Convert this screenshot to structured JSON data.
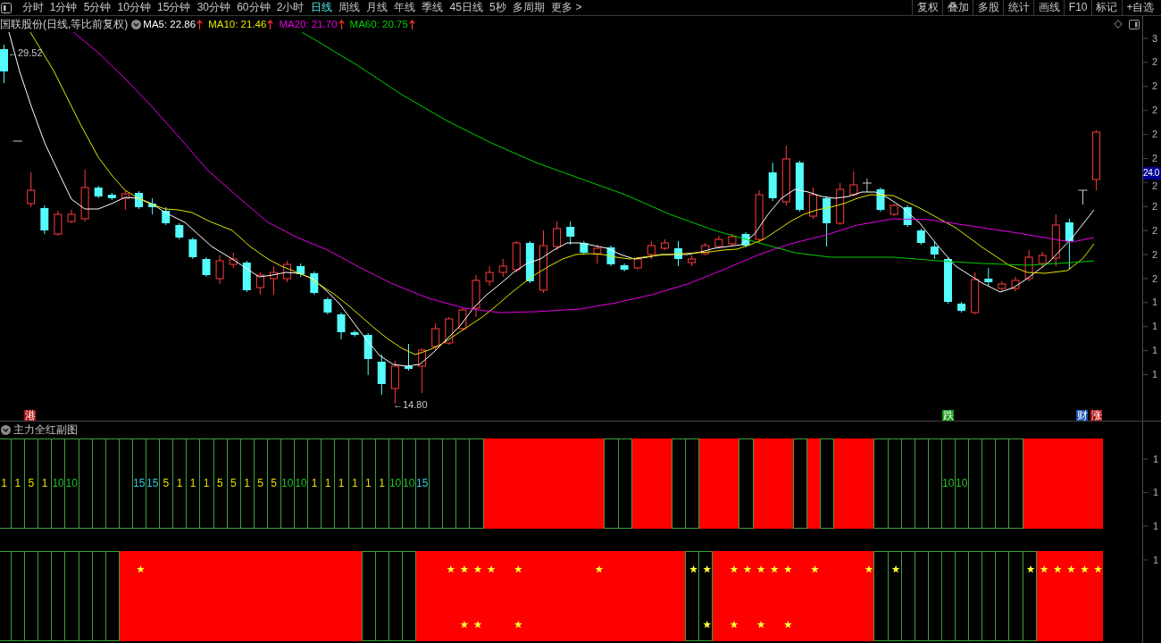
{
  "toolbar": {
    "periods": [
      {
        "label": "分时",
        "selected": false
      },
      {
        "label": "1分钟",
        "selected": false
      },
      {
        "label": "5分钟",
        "selected": false
      },
      {
        "label": "10分钟",
        "selected": false
      },
      {
        "label": "15分钟",
        "selected": false
      },
      {
        "label": "30分钟",
        "selected": false
      },
      {
        "label": "60分钟",
        "selected": false
      },
      {
        "label": "2小时",
        "selected": false
      },
      {
        "label": "日线",
        "selected": true
      },
      {
        "label": "周线",
        "selected": false
      },
      {
        "label": "月线",
        "selected": false
      },
      {
        "label": "年线",
        "selected": false
      },
      {
        "label": "季线",
        "selected": false
      },
      {
        "label": "45日线",
        "selected": false
      },
      {
        "label": "5秒",
        "selected": false
      },
      {
        "label": "多周期",
        "selected": false
      },
      {
        "label": "更多 >",
        "selected": false
      }
    ],
    "actions": [
      "复权",
      "叠加",
      "多股",
      "统计",
      "画线",
      "F10",
      "标记",
      "+自选"
    ]
  },
  "chart_header": {
    "title": "国联股份(日线,等比前复权)",
    "indicators": [
      {
        "label": "MA5: 22.86",
        "color": "#ffffff",
        "rising": true
      },
      {
        "label": "MA10: 21.46",
        "color": "#e6e600",
        "rising": true
      },
      {
        "label": "MA20: 21.70",
        "color": "#e600e6",
        "rising": true
      },
      {
        "label": "MA60: 20.75",
        "color": "#00d000",
        "rising": true
      }
    ]
  },
  "main_chart": {
    "high_label": "←29.52",
    "low_label": "←14.80",
    "markers": [
      {
        "text": "港",
        "color": "#b01010"
      },
      {
        "text": "跌",
        "color": "#109a10"
      },
      {
        "text": "财",
        "color": "#1050b0"
      },
      {
        "text": "涨",
        "color": "#b01010"
      }
    ],
    "axis_labels": [
      "3",
      "2",
      "2",
      "2",
      "2",
      "2",
      "2",
      "2",
      "2",
      "2",
      "2",
      "1",
      "1",
      "1",
      "1"
    ],
    "price_tag": "24.0"
  },
  "sub_chart": {
    "title": "主力全红副图",
    "panels": [
      {
        "axis_labels": [
          "1",
          "1",
          "1"
        ],
        "columns": [
          {
            "kind": "outline",
            "label": "1",
            "color": "#e0e000"
          },
          {
            "kind": "outline",
            "label": "1",
            "color": "#e0e000"
          },
          {
            "kind": "outline",
            "label": "5",
            "color": "#e0e000"
          },
          {
            "kind": "outline",
            "label": "1",
            "color": "#e0e000"
          },
          {
            "kind": "outline",
            "label": "10",
            "color": "#20c020"
          },
          {
            "kind": "outline",
            "label": "10",
            "color": "#20c020"
          },
          {
            "kind": "outline"
          },
          {
            "kind": "outline"
          },
          {
            "kind": "outline"
          },
          {
            "kind": "outline"
          },
          {
            "kind": "outline",
            "label": "15",
            "color": "#30c8e0"
          },
          {
            "kind": "outline",
            "label": "15",
            "color": "#30c8e0"
          },
          {
            "kind": "outline",
            "label": "5",
            "color": "#e0e000"
          },
          {
            "kind": "outline",
            "label": "1",
            "color": "#e0e000"
          },
          {
            "kind": "outline",
            "label": "1",
            "color": "#e0e000"
          },
          {
            "kind": "outline",
            "label": "1",
            "color": "#e0e000"
          },
          {
            "kind": "outline",
            "label": "5",
            "color": "#e0e000"
          },
          {
            "kind": "outline",
            "label": "5",
            "color": "#e0e000"
          },
          {
            "kind": "outline",
            "label": "1",
            "color": "#e0e000"
          },
          {
            "kind": "outline",
            "label": "5",
            "color": "#e0e000"
          },
          {
            "kind": "outline",
            "label": "5",
            "color": "#e0e000"
          },
          {
            "kind": "outline",
            "label": "10",
            "color": "#20c020"
          },
          {
            "kind": "outline",
            "label": "10",
            "color": "#20c020"
          },
          {
            "kind": "outline",
            "label": "1",
            "color": "#e0e000"
          },
          {
            "kind": "outline",
            "label": "1",
            "color": "#e0e000"
          },
          {
            "kind": "outline",
            "label": "1",
            "color": "#e0e000"
          },
          {
            "kind": "outline",
            "label": "1",
            "color": "#e0e000"
          },
          {
            "kind": "outline",
            "label": "1",
            "color": "#e0e000"
          },
          {
            "kind": "outline",
            "label": "1",
            "color": "#e0e000"
          },
          {
            "kind": "outline",
            "label": "10",
            "color": "#20c020"
          },
          {
            "kind": "outline",
            "label": "10",
            "color": "#20c020"
          },
          {
            "kind": "outline",
            "label": "15",
            "color": "#30c8e0"
          },
          {
            "kind": "outline"
          },
          {
            "kind": "outline"
          },
          {
            "kind": "outline"
          },
          {
            "kind": "outline"
          },
          {
            "kind": "solid"
          },
          {
            "kind": "solid"
          },
          {
            "kind": "solid"
          },
          {
            "kind": "solid"
          },
          {
            "kind": "solid"
          },
          {
            "kind": "solid"
          },
          {
            "kind": "solid"
          },
          {
            "kind": "solid"
          },
          {
            "kind": "solid"
          },
          {
            "kind": "outline"
          },
          {
            "kind": "outline"
          },
          {
            "kind": "solid"
          },
          {
            "kind": "solid"
          },
          {
            "kind": "solid"
          },
          {
            "kind": "outline"
          },
          {
            "kind": "outline"
          },
          {
            "kind": "solid"
          },
          {
            "kind": "solid"
          },
          {
            "kind": "solid"
          },
          {
            "kind": "outline"
          },
          {
            "kind": "solid"
          },
          {
            "kind": "solid"
          },
          {
            "kind": "solid"
          },
          {
            "kind": "outline"
          },
          {
            "kind": "solid"
          },
          {
            "kind": "outline"
          },
          {
            "kind": "solid"
          },
          {
            "kind": "solid"
          },
          {
            "kind": "solid"
          },
          {
            "kind": "outline"
          },
          {
            "kind": "outline"
          },
          {
            "kind": "outline"
          },
          {
            "kind": "outline"
          },
          {
            "kind": "outline"
          },
          {
            "kind": "outline",
            "label": "10",
            "color": "#20c020"
          },
          {
            "kind": "outline",
            "label": "10",
            "color": "#20c020"
          },
          {
            "kind": "outline"
          },
          {
            "kind": "outline"
          },
          {
            "kind": "outline"
          },
          {
            "kind": "outline"
          },
          {
            "kind": "solid"
          },
          {
            "kind": "solid"
          },
          {
            "kind": "solid"
          },
          {
            "kind": "solid"
          },
          {
            "kind": "solid"
          },
          {
            "kind": "solid"
          }
        ]
      },
      {
        "axis_labels": [
          "1"
        ],
        "columns": [
          {
            "kind": "outline",
            "upper_star": false,
            "lower_star": false
          },
          {
            "kind": "outline",
            "upper_star": false,
            "lower_star": false
          },
          {
            "kind": "outline",
            "upper_star": false,
            "lower_star": false
          },
          {
            "kind": "outline",
            "upper_star": false,
            "lower_star": false
          },
          {
            "kind": "outline",
            "upper_star": false,
            "lower_star": false
          },
          {
            "kind": "outline",
            "upper_star": false,
            "lower_star": false
          },
          {
            "kind": "outline",
            "upper_star": false,
            "lower_star": false
          },
          {
            "kind": "outline",
            "upper_star": false,
            "lower_star": false
          },
          {
            "kind": "outline",
            "upper_star": false,
            "lower_star": false
          },
          {
            "kind": "solid",
            "upper_star": false,
            "lower_star": false
          },
          {
            "kind": "solid",
            "upper_star": true,
            "lower_star": false
          },
          {
            "kind": "solid",
            "upper_star": false,
            "lower_star": false
          },
          {
            "kind": "solid",
            "upper_star": false,
            "lower_star": false
          },
          {
            "kind": "solid",
            "upper_star": false,
            "lower_star": false
          },
          {
            "kind": "solid",
            "upper_star": false,
            "lower_star": false
          },
          {
            "kind": "solid",
            "upper_star": false,
            "lower_star": false
          },
          {
            "kind": "solid",
            "upper_star": false,
            "lower_star": false
          },
          {
            "kind": "solid",
            "upper_star": false,
            "lower_star": false
          },
          {
            "kind": "solid",
            "upper_star": false,
            "lower_star": false
          },
          {
            "kind": "solid",
            "upper_star": false,
            "lower_star": false
          },
          {
            "kind": "solid",
            "upper_star": false,
            "lower_star": false
          },
          {
            "kind": "solid",
            "upper_star": false,
            "lower_star": false
          },
          {
            "kind": "solid",
            "upper_star": false,
            "lower_star": false
          },
          {
            "kind": "solid",
            "upper_star": false,
            "lower_star": false
          },
          {
            "kind": "solid",
            "upper_star": false,
            "lower_star": false
          },
          {
            "kind": "solid",
            "upper_star": false,
            "lower_star": false
          },
          {
            "kind": "solid",
            "upper_star": false,
            "lower_star": false
          },
          {
            "kind": "outline",
            "upper_star": false,
            "lower_star": false
          },
          {
            "kind": "outline",
            "upper_star": false,
            "lower_star": false
          },
          {
            "kind": "outline",
            "upper_star": false,
            "lower_star": false
          },
          {
            "kind": "outline",
            "upper_star": false,
            "lower_star": false
          },
          {
            "kind": "solid",
            "upper_star": false,
            "lower_star": false
          },
          {
            "kind": "solid",
            "upper_star": false,
            "lower_star": false
          },
          {
            "kind": "solid",
            "upper_star": true,
            "lower_star": false
          },
          {
            "kind": "solid",
            "upper_star": true,
            "lower_star": true
          },
          {
            "kind": "solid",
            "upper_star": true,
            "lower_star": true
          },
          {
            "kind": "solid",
            "upper_star": true,
            "lower_star": false
          },
          {
            "kind": "solid",
            "upper_star": false,
            "lower_star": false
          },
          {
            "kind": "solid",
            "upper_star": true,
            "lower_star": true
          },
          {
            "kind": "solid",
            "upper_star": false,
            "lower_star": false
          },
          {
            "kind": "solid",
            "upper_star": false,
            "lower_star": false
          },
          {
            "kind": "solid",
            "upper_star": false,
            "lower_star": false
          },
          {
            "kind": "solid",
            "upper_star": false,
            "lower_star": false
          },
          {
            "kind": "solid",
            "upper_star": false,
            "lower_star": false
          },
          {
            "kind": "solid",
            "upper_star": true,
            "lower_star": false
          },
          {
            "kind": "solid",
            "upper_star": false,
            "lower_star": false
          },
          {
            "kind": "solid",
            "upper_star": false,
            "lower_star": false
          },
          {
            "kind": "solid",
            "upper_star": false,
            "lower_star": false
          },
          {
            "kind": "solid",
            "upper_star": false,
            "lower_star": false
          },
          {
            "kind": "solid",
            "upper_star": false,
            "lower_star": false
          },
          {
            "kind": "solid",
            "upper_star": false,
            "lower_star": false
          },
          {
            "kind": "outline",
            "upper_star": true,
            "lower_star": false
          },
          {
            "kind": "outline",
            "upper_star": true,
            "lower_star": true
          },
          {
            "kind": "solid",
            "upper_star": false,
            "lower_star": false
          },
          {
            "kind": "solid",
            "upper_star": true,
            "lower_star": true
          },
          {
            "kind": "solid",
            "upper_star": true,
            "lower_star": false
          },
          {
            "kind": "solid",
            "upper_star": true,
            "lower_star": true
          },
          {
            "kind": "solid",
            "upper_star": true,
            "lower_star": false
          },
          {
            "kind": "solid",
            "upper_star": true,
            "lower_star": true
          },
          {
            "kind": "solid",
            "upper_star": false,
            "lower_star": false
          },
          {
            "kind": "solid",
            "upper_star": true,
            "lower_star": false
          },
          {
            "kind": "solid",
            "upper_star": false,
            "lower_star": false
          },
          {
            "kind": "solid",
            "upper_star": false,
            "lower_star": false
          },
          {
            "kind": "solid",
            "upper_star": false,
            "lower_star": false
          },
          {
            "kind": "solid",
            "upper_star": true,
            "lower_star": false
          },
          {
            "kind": "outline",
            "upper_star": false,
            "lower_star": false
          },
          {
            "kind": "outline",
            "upper_star": true,
            "lower_star": false
          },
          {
            "kind": "outline",
            "upper_star": false,
            "lower_star": false
          },
          {
            "kind": "outline",
            "upper_star": false,
            "lower_star": false
          },
          {
            "kind": "outline",
            "upper_star": false,
            "lower_star": false
          },
          {
            "kind": "outline",
            "upper_star": false,
            "lower_star": false
          },
          {
            "kind": "outline",
            "upper_star": false,
            "lower_star": false
          },
          {
            "kind": "outline",
            "upper_star": false,
            "lower_star": false
          },
          {
            "kind": "outline",
            "upper_star": false,
            "lower_star": false
          },
          {
            "kind": "outline",
            "upper_star": false,
            "lower_star": false
          },
          {
            "kind": "outline",
            "upper_star": false,
            "lower_star": false
          },
          {
            "kind": "outline",
            "upper_star": true,
            "lower_star": false
          },
          {
            "kind": "solid",
            "upper_star": true,
            "lower_star": false
          },
          {
            "kind": "solid",
            "upper_star": true,
            "lower_star": false
          },
          {
            "kind": "solid",
            "upper_star": true,
            "lower_star": false
          },
          {
            "kind": "solid",
            "upper_star": true,
            "lower_star": false
          },
          {
            "kind": "solid",
            "upper_star": true,
            "lower_star": false
          }
        ]
      }
    ]
  }
}
